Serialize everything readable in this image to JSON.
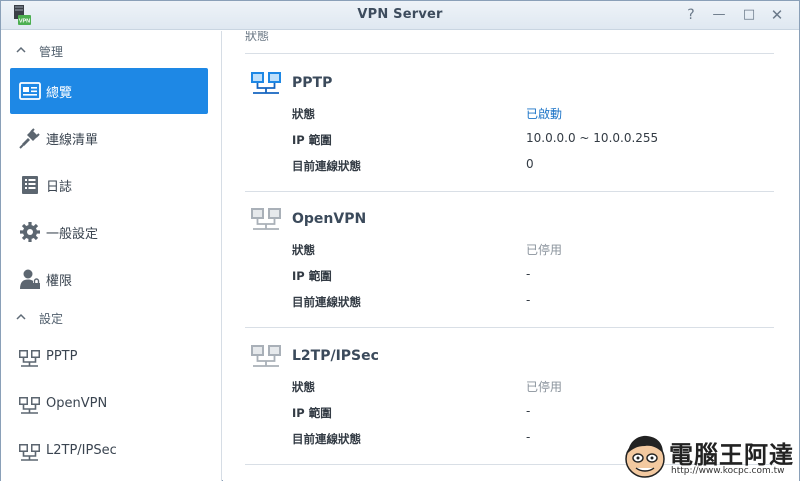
{
  "window": {
    "title": "VPN Server",
    "app_icon": "vpn-server-app-icon",
    "app_icon_badge": "VPN"
  },
  "controls": {
    "help": "?",
    "minimize": "—",
    "maximize": "□",
    "close": "✕"
  },
  "sidebar": {
    "sections": [
      {
        "label": "管理",
        "icon": "chevron-up-icon"
      },
      {
        "label": "設定",
        "icon": "chevron-up-icon"
      }
    ],
    "items": [
      {
        "label": "總覽",
        "icon": "overview-icon",
        "active": true
      },
      {
        "label": "連線清單",
        "icon": "plug-icon"
      },
      {
        "label": "日誌",
        "icon": "log-icon"
      },
      {
        "label": "一般設定",
        "icon": "gear-icon"
      },
      {
        "label": "權限",
        "icon": "user-lock-icon"
      },
      {
        "label": "PPTP",
        "icon": "network-icon"
      },
      {
        "label": "OpenVPN",
        "icon": "network-icon"
      },
      {
        "label": "L2TP/IPSec",
        "icon": "network-icon"
      }
    ]
  },
  "main": {
    "tab_label": "狀態",
    "services": [
      {
        "name": "PPTP",
        "icon": "network-icon",
        "enabled": true,
        "rows": [
          {
            "label": "狀態",
            "value": "已啟動"
          },
          {
            "label": "IP 範圍",
            "value": "10.0.0.0 ~ 10.0.0.255"
          },
          {
            "label": "目前連線狀態",
            "value": "0"
          }
        ]
      },
      {
        "name": "OpenVPN",
        "icon": "network-icon",
        "enabled": false,
        "rows": [
          {
            "label": "狀態",
            "value": "已停用"
          },
          {
            "label": "IP 範圍",
            "value": "-"
          },
          {
            "label": "目前連線狀態",
            "value": "-"
          }
        ]
      },
      {
        "name": "L2TP/IPSec",
        "icon": "network-icon",
        "enabled": false,
        "rows": [
          {
            "label": "狀態",
            "value": "已停用"
          },
          {
            "label": "IP 範圍",
            "value": "-"
          },
          {
            "label": "目前連線狀態",
            "value": "-"
          }
        ]
      }
    ]
  },
  "watermark": {
    "title": "電腦王阿達",
    "url": "http://www.kocpc.com.tw",
    "icon": "mascot-face-icon"
  },
  "colors": {
    "accent": "#1e88e5",
    "status_on": "#1a73c7",
    "status_off": "#8a939c"
  }
}
